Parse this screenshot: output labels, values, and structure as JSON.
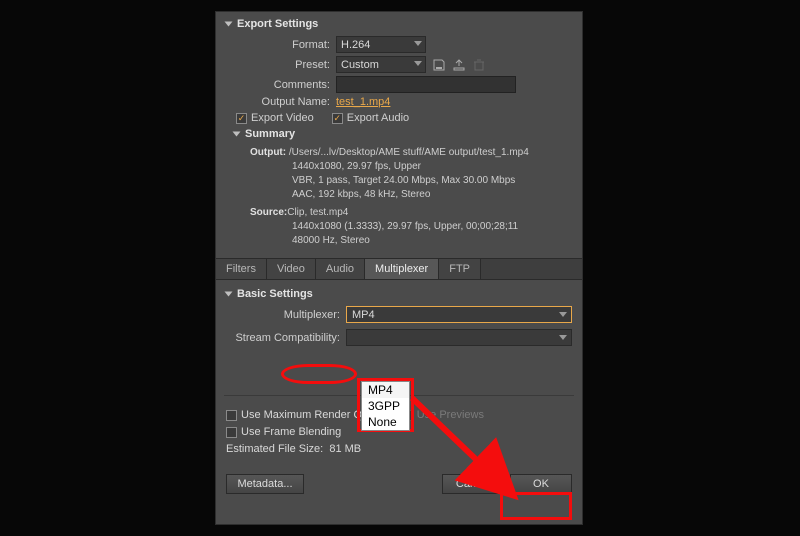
{
  "exportSettings": {
    "title": "Export Settings",
    "formatLabel": "Format:",
    "formatValue": "H.264",
    "presetLabel": "Preset:",
    "presetValue": "Custom",
    "commentsLabel": "Comments:",
    "commentsValue": "",
    "outputNameLabel": "Output Name:",
    "outputNameValue": "test_1.mp4",
    "exportVideo": "Export Video",
    "exportAudio": "Export Audio"
  },
  "summary": {
    "title": "Summary",
    "outputLabel": "Output:",
    "outputPath": "/Users/...lv/Desktop/AME stuff/AME output/test_1.mp4",
    "outputLine2": "1440x1080, 29.97 fps, Upper",
    "outputLine3": "VBR, 1 pass, Target 24.00 Mbps, Max 30.00 Mbps",
    "outputLine4": "AAC, 192 kbps, 48 kHz, Stereo",
    "sourceLabel": "Source:",
    "sourceLine1": "Clip, test.mp4",
    "sourceLine2": "1440x1080 (1.3333), 29.97 fps, Upper, 00;00;28;11",
    "sourceLine3": "48000 Hz, Stereo"
  },
  "tabs": [
    "Filters",
    "Video",
    "Audio",
    "Multiplexer",
    "FTP"
  ],
  "activeTab": "Multiplexer",
  "basic": {
    "title": "Basic Settings",
    "muxLabel": "Multiplexer:",
    "muxValue": "MP4",
    "streamLabel": "Stream Compatibility:",
    "streamValue": "",
    "options": [
      "MP4",
      "3GPP",
      "None"
    ]
  },
  "footer": {
    "maxRender": "Use Maximum Render Quality",
    "usePreviews": "Use Previews",
    "frameBlend": "Use Frame Blending",
    "estLabel": "Estimated File Size:",
    "estValue": "81 MB",
    "metadata": "Metadata...",
    "cancel": "Cancel",
    "ok": "OK"
  }
}
